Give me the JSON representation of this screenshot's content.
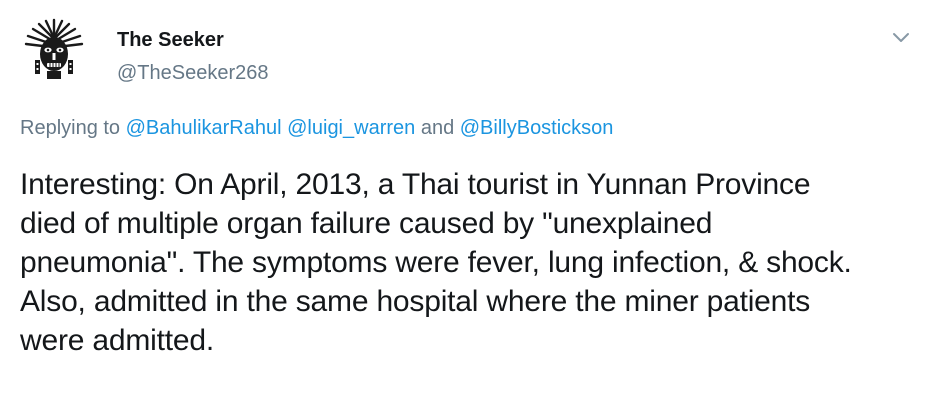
{
  "author": {
    "display_name": "The Seeker",
    "handle": "@TheSeeker268",
    "avatar_icon": "tribal-mask-avatar"
  },
  "menu": {
    "icon": "chevron-down-icon"
  },
  "reply": {
    "prefix": "Replying to ",
    "mentions": [
      "@BahulikarRahul",
      "@luigi_warren",
      "@BillyBostickson"
    ],
    "separator_1": " ",
    "separator_2": " and "
  },
  "tweet": {
    "text": "Interesting: On April, 2013, a Thai tourist in Yunnan Province\ndied of multiple organ failure caused by \"unexplained\npneumonia\". The symptoms were fever, lung infection, & shock.\nAlso, admitted in the same hospital where the miner patients\nwere admitted."
  },
  "colors": {
    "text": "#14171a",
    "secondary": "#657786",
    "link": "#1b95e0"
  }
}
